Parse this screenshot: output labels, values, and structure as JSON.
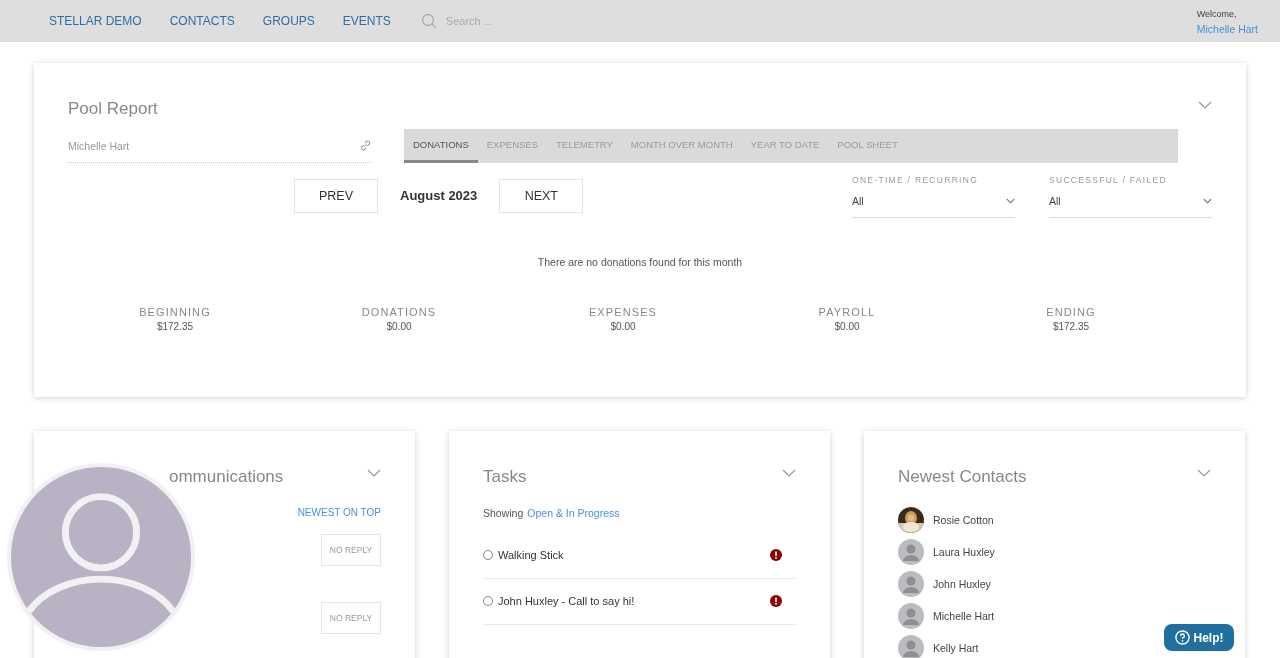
{
  "nav": {
    "items": [
      {
        "label": "STELLAR DEMO"
      },
      {
        "label": "CONTACTS"
      },
      {
        "label": "GROUPS"
      },
      {
        "label": "EVENTS"
      }
    ],
    "search_placeholder": "Search ...",
    "welcome": "Welcome,",
    "user": "Michelle Hart"
  },
  "pool_report": {
    "title": "Pool Report",
    "person": "Michelle Hart",
    "tabs": [
      {
        "label": "DONATIONS",
        "selected": true
      },
      {
        "label": "EXPENSES",
        "selected": false
      },
      {
        "label": "TELEMETRY",
        "selected": false
      },
      {
        "label": "MONTH OVER MONTH",
        "selected": false
      },
      {
        "label": "YEAR TO DATE",
        "selected": false
      },
      {
        "label": "POOL SHEET",
        "selected": false
      }
    ],
    "prev": "PREV",
    "month": "August 2023",
    "next": "NEXT",
    "filters": [
      {
        "label": "ONE-TIME / RECURRING",
        "value": "All"
      },
      {
        "label": "SUCCESSFUL / FAILED",
        "value": "All"
      }
    ],
    "empty_message": "There are no donations found for this month",
    "summary": [
      {
        "label": "BEGINNING",
        "value": "$172.35"
      },
      {
        "label": "DONATIONS",
        "value": "$0.00"
      },
      {
        "label": "EXPENSES",
        "value": "$0.00"
      },
      {
        "label": "PAYROLL",
        "value": "$0.00"
      },
      {
        "label": "ENDING",
        "value": "$172.35"
      }
    ]
  },
  "communications": {
    "title": "ommunications",
    "sort": "NEWEST ON TOP",
    "items": [
      {
        "status": "NO REPLY"
      },
      {
        "status": "NO REPLY"
      }
    ]
  },
  "tasks": {
    "title": "Tasks",
    "showing": "Showing",
    "filter": "Open & In Progress",
    "items": [
      {
        "label": "Walking Stick",
        "checked": false,
        "urgent": true
      },
      {
        "label": "John Huxley - Call to say hi!",
        "checked": false,
        "urgent": true
      }
    ]
  },
  "contacts": {
    "title": "Newest Contacts",
    "items": [
      {
        "name": "Rosie Cotton"
      },
      {
        "name": "Laura Huxley",
        "kind": "default"
      },
      {
        "name": "John Huxley",
        "kind": "default"
      },
      {
        "name": "Michelle Hart",
        "kind": "default"
      },
      {
        "name": "Kelly Hart",
        "kind": "default"
      }
    ]
  },
  "help": "Help!"
}
